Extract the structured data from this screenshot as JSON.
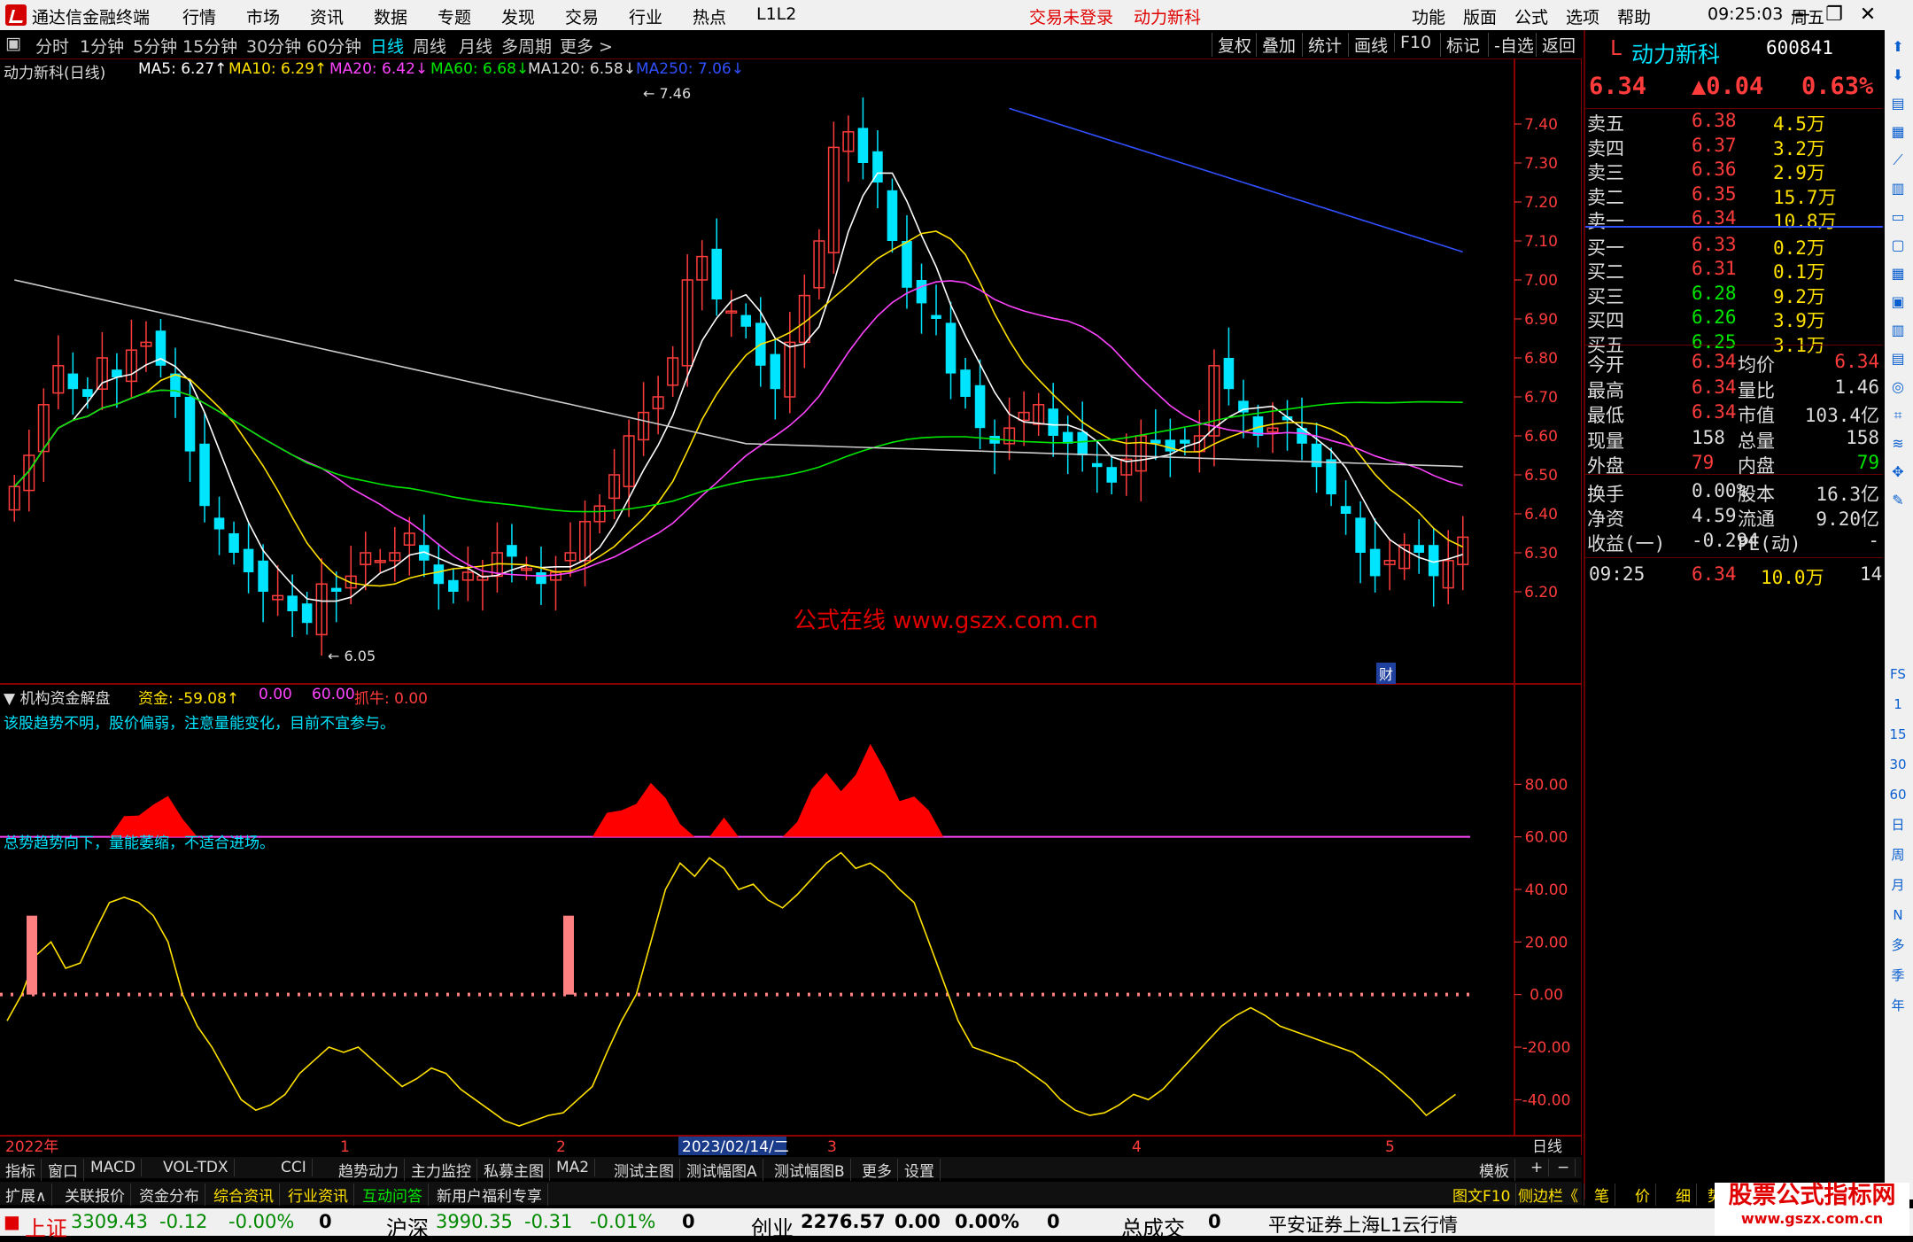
{
  "titlebar": {
    "app_title": "通达信金融终端",
    "menus": [
      "行情",
      "市场",
      "资讯",
      "数据",
      "专题",
      "发现",
      "交易",
      "行业",
      "热点",
      "L1L2"
    ],
    "login_status": "交易未登录",
    "stock_title": "动力新科",
    "right_menus": [
      "功能",
      "版面",
      "公式",
      "选项",
      "帮助"
    ],
    "time": "09:25:03",
    "weekday": "周五",
    "min_icon": "minimize-icon",
    "max_icon": "restore-icon",
    "close_icon": "close-icon"
  },
  "toolbar": {
    "periods": [
      "分时",
      "1分钟",
      "5分钟",
      "15分钟",
      "30分钟",
      "60分钟",
      "日线",
      "周线",
      "月线",
      "多周期",
      "更多 >"
    ],
    "active_period": "日线",
    "right_buttons": [
      "复权",
      "叠加",
      "统计",
      "画线",
      "F10",
      "标记",
      "-自选",
      "返回"
    ]
  },
  "main_chart": {
    "legend_title": "动力新科(日线)",
    "ma": [
      {
        "label": "MA5: 6.27↑",
        "color": "#ffffff"
      },
      {
        "label": "MA10: 6.29↑",
        "color": "#ffe100"
      },
      {
        "label": "MA20: 6.42↓",
        "color": "#ff44ff"
      },
      {
        "label": "MA60: 6.68↓",
        "color": "#00e600"
      },
      {
        "label": "MA120: 6.58↓",
        "color": "#dddddd"
      },
      {
        "label": "MA250: 7.06↓",
        "color": "#3050ff"
      }
    ],
    "high_marker": "7.46",
    "low_marker": "6.05",
    "watermark": "公式在线  www.gszx.com.cn",
    "fin_badge": "财",
    "y_ticks": [
      "7.40",
      "7.30",
      "7.20",
      "7.10",
      "7.00",
      "6.90",
      "6.80",
      "6.70",
      "6.60",
      "6.50",
      "6.40",
      "6.30",
      "6.20"
    ]
  },
  "indicator": {
    "name": "机构资金解盘",
    "legend": [
      {
        "label": "资金: -59.08↑",
        "color": "#ffe100"
      },
      {
        "label": "0.00",
        "color": "#ff44ff"
      },
      {
        "label": "60.00",
        "color": "#ff44ff"
      },
      {
        "label": "抓牛: 0.00",
        "color": "#ff3c3c"
      }
    ],
    "note1": "该股趋势不明，股价偏弱，注意量能变化，目前不宜参与。",
    "note2": "总势趋势向下，量能萎缩，不适合进场。",
    "y_ticks": [
      "80.00",
      "60.00",
      "40.00",
      "20.00",
      "0.00",
      "-20.00",
      "-40.00"
    ]
  },
  "x_axis": {
    "labels": [
      "2022年",
      "1",
      "2",
      "2023/02/14/二",
      "3",
      "4",
      "5"
    ],
    "period_label": "日线"
  },
  "quote": {
    "market_tag": "L",
    "name": "动力新科",
    "code": "600841",
    "price": "6.34",
    "change": "▲0.04",
    "change_pct": "0.63%",
    "asks": [
      {
        "label": "卖五",
        "price": "6.38",
        "vol": "4.5万"
      },
      {
        "label": "卖四",
        "price": "6.37",
        "vol": "3.2万"
      },
      {
        "label": "卖三",
        "price": "6.36",
        "vol": "2.9万"
      },
      {
        "label": "卖二",
        "price": "6.35",
        "vol": "15.7万"
      },
      {
        "label": "卖一",
        "price": "6.34",
        "vol": "10.8万"
      }
    ],
    "bids": [
      {
        "label": "买一",
        "price": "6.33",
        "vol": "0.2万"
      },
      {
        "label": "买二",
        "price": "6.31",
        "vol": "0.1万"
      },
      {
        "label": "买三",
        "price": "6.28",
        "vol": "9.2万"
      },
      {
        "label": "买四",
        "price": "6.26",
        "vol": "3.9万"
      },
      {
        "label": "买五",
        "price": "6.25",
        "vol": "3.1万"
      }
    ],
    "stats": [
      {
        "l1": "今开",
        "v1": "6.34",
        "l2": "均价",
        "v2": "6.34"
      },
      {
        "l1": "最高",
        "v1": "6.34",
        "l2": "量比",
        "v2": "1.46"
      },
      {
        "l1": "最低",
        "v1": "6.34",
        "l2": "市值",
        "v2": "103.4亿"
      },
      {
        "l1": "现量",
        "v1": "158",
        "l2": "总量",
        "v2": "158"
      },
      {
        "l1": "外盘",
        "v1": "79",
        "l2": "内盘",
        "v2": "79"
      }
    ],
    "stats2": [
      {
        "l1": "换手",
        "v1": "0.00%",
        "l2": "股本",
        "v2": "16.3亿"
      },
      {
        "l1": "净资",
        "v1": "4.59",
        "l2": "流通",
        "v2": "9.20亿"
      },
      {
        "l1": "收益(一)",
        "v1": "-0.294",
        "l2": "PE(动)",
        "v2": "-"
      }
    ],
    "tick": {
      "time": "09:25",
      "price": "6.34",
      "vol": "10.0万",
      "count": "14"
    }
  },
  "side_icons": [
    "arrow-up-icon",
    "arrow-down-icon",
    "list-icon",
    "grid-icon",
    "chart-icon",
    "kline-icon",
    "doc-icon",
    "fin-icon",
    "table-icon",
    "grid2-icon",
    "f2-icon",
    "f3-icon",
    "circle-icon",
    "rsi-icon",
    "rsi-label-icon",
    "move-icon",
    "pen-icon"
  ],
  "side_labels": [
    "FS",
    "1",
    "15",
    "30",
    "60",
    "日",
    "周",
    "月",
    "N",
    "多",
    "季",
    "年"
  ],
  "tabs1": [
    "指标",
    "窗口",
    "MACD",
    "VOL-TDX",
    "CCI",
    "趋势动力",
    "主力监控",
    "私募主图",
    "MA2",
    "测试主图",
    "测试幅图A",
    "测试幅图B",
    "更多",
    "设置",
    "模板",
    "+",
    "−"
  ],
  "tabs2": [
    "扩展∧",
    "关联报价",
    "资金分布",
    "综合资讯",
    "行业资讯",
    "互动问答",
    "新用户福利专享",
    "图文F10",
    "侧边栏《",
    "笔",
    "价",
    "细",
    "势"
  ],
  "status": {
    "sh_name": "上证",
    "sh_val": "3309.43",
    "sh_chg": "-0.12",
    "sh_pct": "-0.00%",
    "sh_vol": "0",
    "hs_name": "沪深",
    "hs_val": "3990.35",
    "hs_chg": "-0.31",
    "hs_pct": "-0.01%",
    "hs_vol": "0",
    "cy_name": "创业",
    "cy_val": "2276.57",
    "cy_chg": "0.00",
    "cy_pct": "0.00%",
    "cy_vol": "0",
    "total_name": "总成交",
    "total_val": "0",
    "server": "平安证券上海L1云行情"
  },
  "watermark_site": {
    "title": "股票公式指标网",
    "url": "www.gszx.com.cn"
  },
  "chart_data": {
    "type": "candlestick",
    "price_range": [
      6.0,
      7.5
    ],
    "candles_close": [
      6.47,
      6.55,
      6.68,
      6.78,
      6.72,
      6.7,
      6.8,
      6.75,
      6.82,
      6.84,
      6.78,
      6.7,
      6.56,
      6.42,
      6.36,
      6.3,
      6.25,
      6.2,
      6.19,
      6.15,
      6.12,
      6.22,
      6.2,
      6.24,
      6.3,
      6.28,
      6.3,
      6.35,
      6.28,
      6.22,
      6.2,
      6.25,
      6.24,
      6.3,
      6.29,
      6.26,
      6.22,
      6.25,
      6.3,
      6.38,
      6.42,
      6.5,
      6.6,
      6.66,
      6.7,
      6.8,
      7.0,
      7.06,
      6.95,
      6.92,
      6.88,
      6.78,
      6.72,
      6.84,
      6.96,
      7.1,
      7.34,
      7.38,
      7.3,
      7.25,
      7.1,
      6.98,
      6.94,
      6.9,
      6.76,
      6.7,
      6.62,
      6.58,
      6.62,
      6.66,
      6.68,
      6.6,
      6.58,
      6.55,
      6.52,
      6.48,
      6.54,
      6.6,
      6.58,
      6.56,
      6.58,
      6.6,
      6.78,
      6.72,
      6.66,
      6.6,
      6.62,
      6.64,
      6.58,
      6.52,
      6.45,
      6.4,
      6.3,
      6.24,
      6.28,
      6.32,
      6.3,
      6.24,
      6.28,
      6.34
    ],
    "ma_values": {
      "MA5": 6.27,
      "MA10": 6.29,
      "MA20": 6.42,
      "MA60": 6.68,
      "MA120": 6.58,
      "MA250": 7.06
    },
    "indicator_range": [
      -50,
      100
    ],
    "jin_values": [
      -10,
      0,
      15,
      20,
      10,
      12,
      24,
      35,
      37,
      35,
      30,
      20,
      0,
      -12,
      -20,
      -30,
      -40,
      -44,
      -42,
      -38,
      -30,
      -25,
      -20,
      -22,
      -20,
      -25,
      -30,
      -35,
      -32,
      -28,
      -30,
      -36,
      -40,
      -44,
      -48,
      -50,
      -48,
      -46,
      -45,
      -40,
      -35,
      -22,
      -10,
      0,
      20,
      40,
      50,
      45,
      52,
      48,
      40,
      42,
      36,
      33,
      38,
      44,
      50,
      54,
      48,
      50,
      46,
      40,
      35,
      20,
      5,
      -10,
      -20,
      -22,
      -24,
      -26,
      -30,
      -34,
      -40,
      -44,
      -46,
      -45,
      -42,
      -38,
      -40,
      -36,
      -30,
      -24,
      -18,
      -12,
      -8,
      -5,
      -8,
      -12,
      -14,
      -16,
      -18,
      -20,
      -22,
      -26,
      -30,
      -35,
      -40,
      -46,
      -42,
      -38
    ]
  }
}
